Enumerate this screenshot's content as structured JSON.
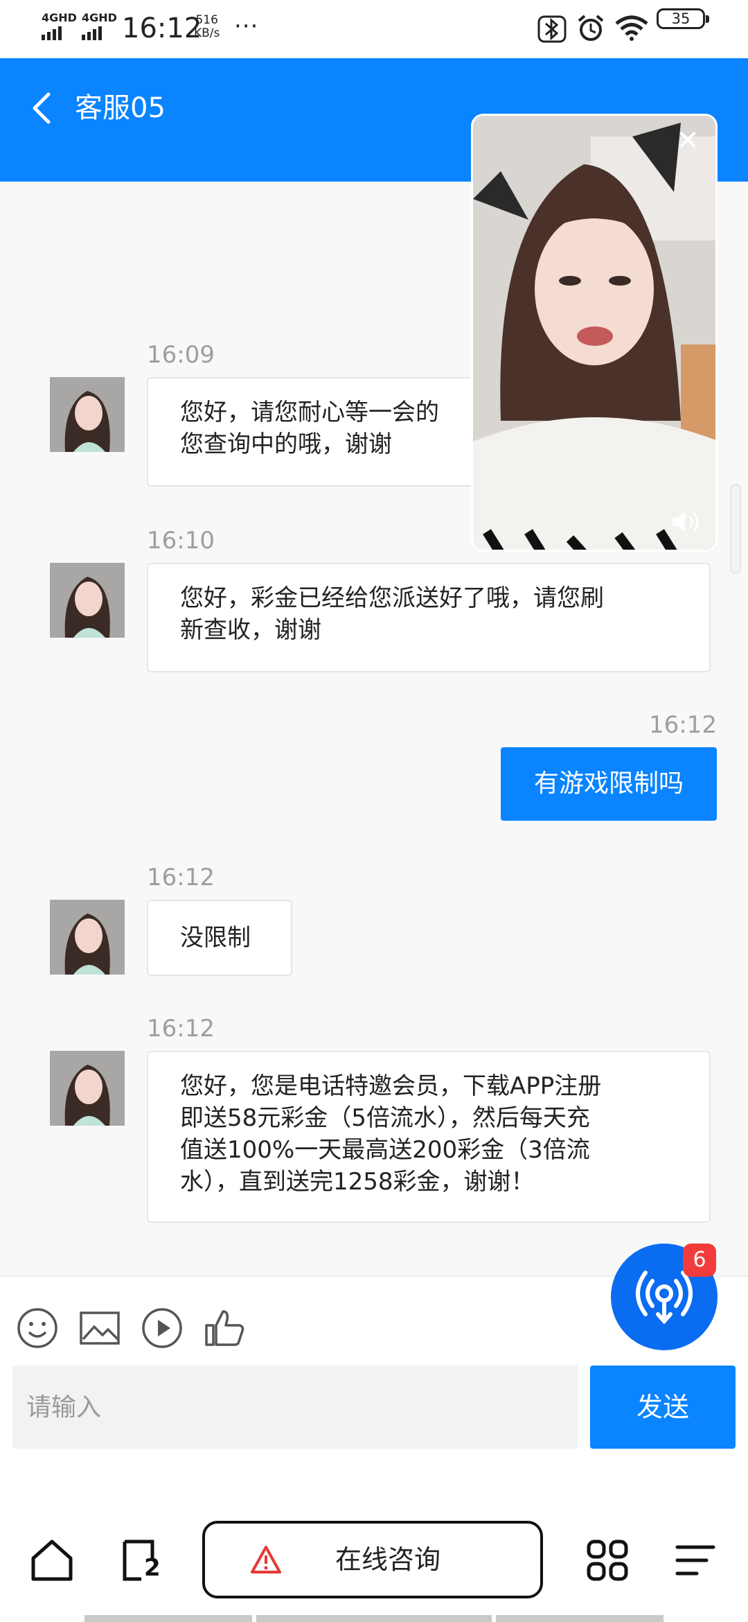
{
  "status_bar": {
    "sim1": "4GHD",
    "sim2": "4GHD",
    "time": "16:12",
    "speed_value": "516",
    "speed_unit": "KB/s",
    "more": "···",
    "battery": "35"
  },
  "header": {
    "title": "客服05"
  },
  "messages": [
    {
      "time": "16:09",
      "text": "您好，请您耐心等一会的\n您查询中的哦，谢谢"
    },
    {
      "time": "16:10",
      "text": "您好，彩金已经给您派送好了哦，请您刷\n新查收，谢谢"
    },
    {
      "time": "16:12",
      "text": "有游戏限制吗",
      "from": "me"
    },
    {
      "time": "16:12",
      "text": "没限制"
    },
    {
      "time": "16:12",
      "text": "您好，您是电话特邀会员，下载APP注册\n即送58元彩金（5倍流水），然后每天充\n值送100%一天最高送200彩金（3倍流\n水），直到送完1258彩金，谢谢！"
    }
  ],
  "fab": {
    "badge": "6"
  },
  "composer": {
    "placeholder": "请输入",
    "send_label": "发送"
  },
  "navbar": {
    "center_label": "在线咨询",
    "tabs_count": "2"
  },
  "colors": {
    "accent": "#0a84ff",
    "badge": "#f23c3c"
  }
}
